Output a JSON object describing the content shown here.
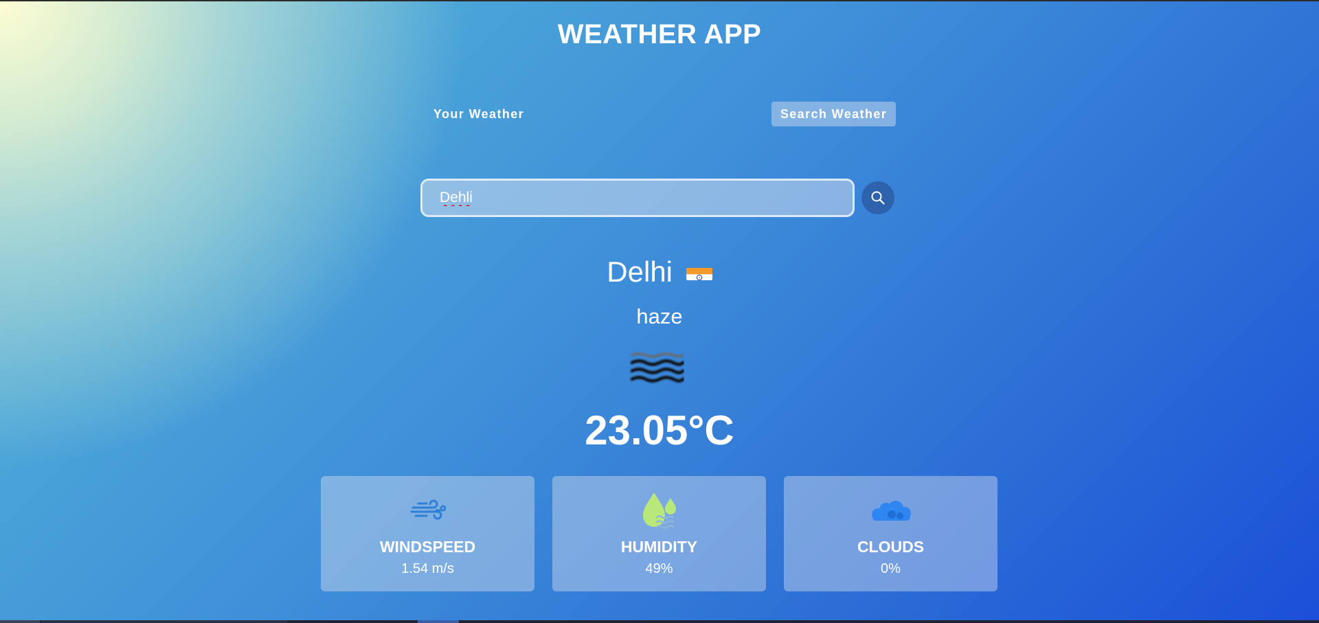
{
  "app": {
    "title": "WEATHER APP"
  },
  "tabs": [
    {
      "label": "Your Weather",
      "active": false
    },
    {
      "label": "Search Weather",
      "active": true
    }
  ],
  "search": {
    "value": "Dehli",
    "button_icon": "search-icon"
  },
  "weather": {
    "city": "Delhi",
    "country_flag": "india-flag",
    "description": "haze",
    "icon": "haze-icon",
    "temperature": "23.05°C"
  },
  "cards": [
    {
      "icon": "wind-icon",
      "label": "WINDSPEED",
      "value": "1.54 m/s"
    },
    {
      "icon": "humidity-icon",
      "label": "HUMIDITY",
      "value": "49%"
    },
    {
      "icon": "clouds-icon",
      "label": "CLOUDS",
      "value": "0%"
    }
  ],
  "colors": {
    "background_start": "#fdfdd3",
    "background_mid": "#3f8fd9",
    "background_end": "#1b4fd8",
    "search_button": "#2f62ad",
    "wind_icon": "#2f7fd6",
    "humidity_icon": "#b9e87a",
    "clouds_icon": "#2f86f0"
  }
}
